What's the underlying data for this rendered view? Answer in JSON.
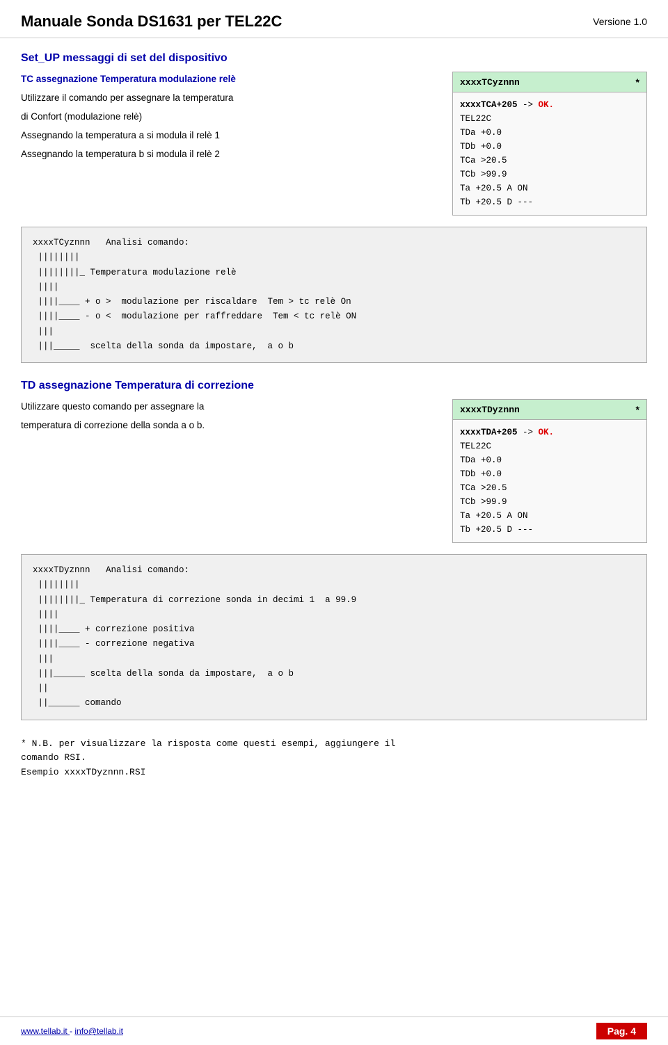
{
  "header": {
    "title": "Manuale Sonda DS1631 per TEL22C",
    "version": "Versione 1.0"
  },
  "section1": {
    "title": "Set_UP  messaggi di set del dispositivo",
    "subtitle": "TC assegnazione Temperatura modulazione relè",
    "description_lines": [
      "Utilizzare il comando  per assegnare la temperatura",
      "di Confort  (modulazione relè)",
      "Assegnando la temperatura a si modula il relè 1",
      "Assegnando la temperatura b si modula il relè 2"
    ],
    "command_box": {
      "header": "xxxxTCyznnn",
      "star": "*",
      "body_line1_bold": "xxxxTCA+205",
      "body_line1_rest": " -> ",
      "body_line1_ok": "OK.",
      "body_lines": [
        "TEL22C",
        "TDa +0.0",
        "TDb +0.0",
        "TCa >20.5",
        "TCb >99.9",
        "Ta +20.5 A ON",
        "Tb +20.5 D ---"
      ]
    },
    "analysis_box": "xxxxTCyznnn   Analisi comando:\n ||||||||\n ||||||||_ Temperatura modulazione relè\n ||||\n ||||____ + o >  modulazione per riscaldare  Tem > tc relè On\n ||||____ - o <  modulazione per raffreddare  Tem < tc relè ON\n |||\n |||_____  scelta della sonda da impostare,  a o b"
  },
  "section2": {
    "title": "TD assegnazione Temperatura di correzione",
    "description_lines": [
      "Utilizzare questo comando  per assegnare la",
      "temperatura di correzione della  sonda a o b."
    ],
    "command_box": {
      "header": "xxxxTDyznnn",
      "star": "*",
      "body_line1_bold": "xxxxTDA+205",
      "body_line1_rest": " -> ",
      "body_line1_ok": "OK.",
      "body_lines": [
        "TEL22C",
        "TDa +0.0",
        "TDb +0.0",
        "TCa >20.5",
        "TCb >99.9",
        "Ta +20.5 A ON",
        "Tb +20.5 D ---"
      ]
    },
    "analysis_box": "xxxxTDyznnn   Analisi comando:\n ||||||||\n ||||||||_ Temperatura di correzione sonda in decimi 1  a 99.9\n ||||\n ||||____ + correzione positiva\n ||||____ - correzione negativa\n |||\n |||______ scelta della sonda da impostare,  a o b\n ||\n ||______ comando"
  },
  "footer_note": {
    "line1": "* N.B.  per visualizzare la risposta come questi esempi, aggiungere il",
    "line2": "comando RSI.",
    "line3": "Esempio xxxxTDyznnn.RSI"
  },
  "footer": {
    "links": "www.tellab.it  -  info@tellab.it",
    "page_label": "Pag.",
    "page_number": "4"
  }
}
